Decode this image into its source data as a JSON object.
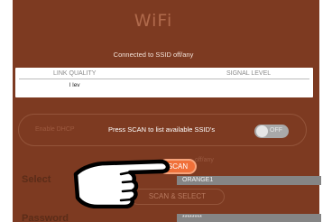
{
  "header": {
    "title": "WiFi"
  },
  "status": {
    "connected": "Connected to SSID off/any"
  },
  "network_table": {
    "columns": [
      "LINK QUALITY",
      "SIGNAL LEVEL"
    ],
    "rows": [
      [
        "l lev",
        ""
      ]
    ]
  },
  "dhcp": {
    "label": "Enable DHCP",
    "toggle_text": "OFF"
  },
  "toast": {
    "message": "Press SCAN to list available SSID's"
  },
  "scan": {
    "button_label": "SCAN",
    "off_any_text": "off/any"
  },
  "ssid": {
    "label": "Select",
    "value": "ORANGE1"
  },
  "scan_select": {
    "label": "SCAN & SELECT"
  },
  "password": {
    "label": "Password",
    "value": "********"
  },
  "colors": {
    "panel_bg": "#7d3a21",
    "accent": "#f07039",
    "field_bg": "#858585"
  },
  "icons": {
    "hand": "pointing-hand-icon"
  }
}
